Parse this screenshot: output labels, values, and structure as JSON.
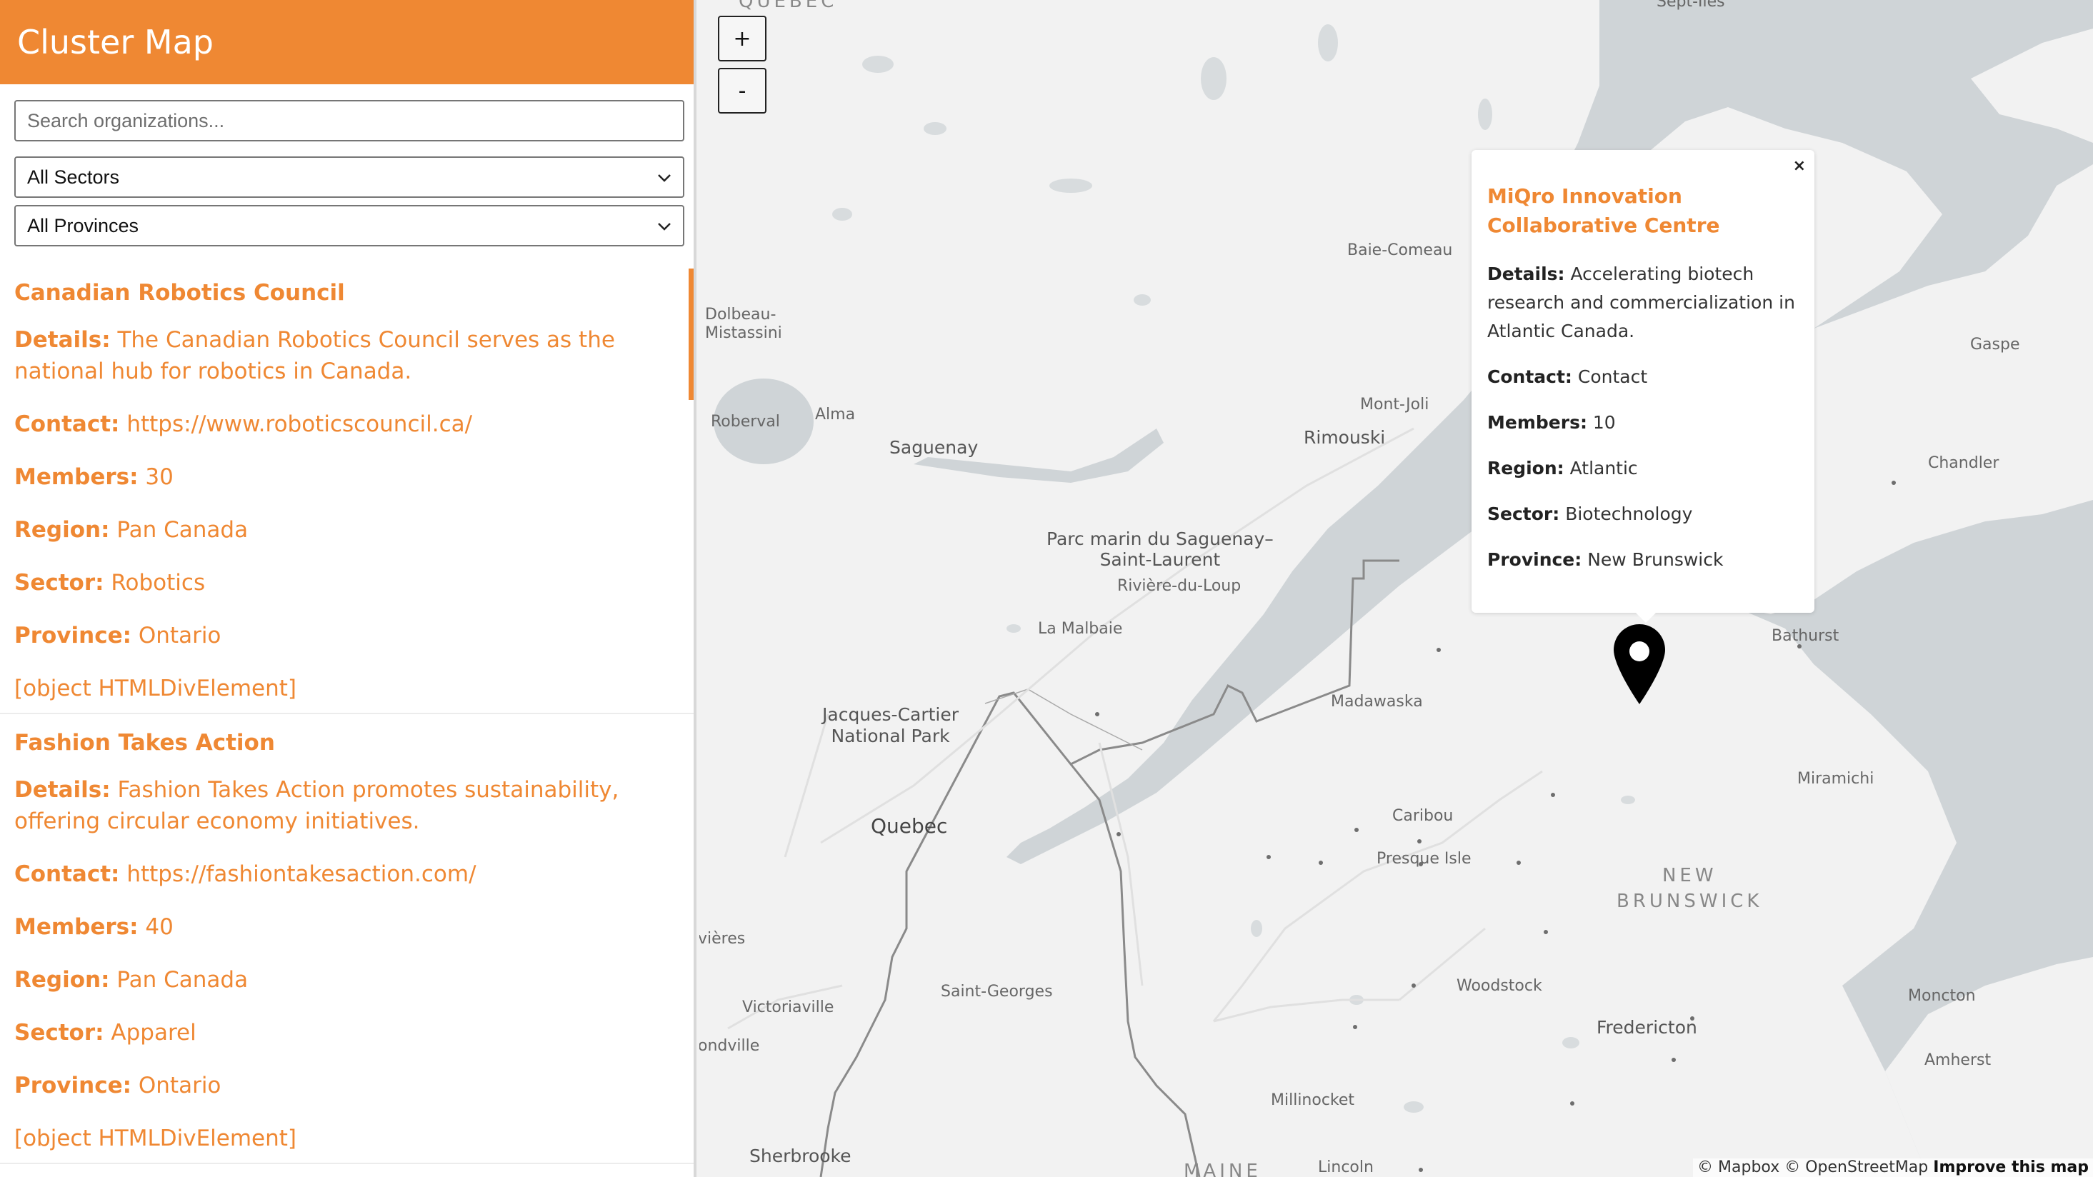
{
  "app": {
    "title": "Cluster Map"
  },
  "filters": {
    "search_placeholder": "Search organizations...",
    "sector_selected": "All Sectors",
    "province_selected": "All Provinces"
  },
  "organizations": [
    {
      "name": "Canadian Robotics Council",
      "details_label": "Details:",
      "details": "The Canadian Robotics Council serves as the national hub for robotics in Canada.",
      "contact_label": "Contact:",
      "contact": "https://www.roboticscouncil.ca/",
      "members_label": "Members:",
      "members": "30",
      "region_label": "Region:",
      "region": "Pan Canada",
      "sector_label": "Sector:",
      "sector": "Robotics",
      "province_label": "Province:",
      "province": "Ontario",
      "extra": "[object HTMLDivElement]"
    },
    {
      "name": "Fashion Takes Action",
      "details_label": "Details:",
      "details": "Fashion Takes Action promotes sustainability, offering circular economy initiatives.",
      "contact_label": "Contact:",
      "contact": "https://fashiontakesaction.com/",
      "members_label": "Members:",
      "members": "40",
      "region_label": "Region:",
      "region": "Pan Canada",
      "sector_label": "Sector:",
      "sector": "Apparel",
      "province_label": "Province:",
      "province": "Ontario",
      "extra": "[object HTMLDivElement]"
    }
  ],
  "map": {
    "zoom_in_label": "+",
    "zoom_out_label": "-",
    "labels": {
      "quebec_region": "QUEBEC",
      "sept_iles": "Sept-Îles",
      "baie_comeau": "Baie-Comeau",
      "dolbeau": "Dolbeau-\nMistassini",
      "roberval": "Roberval",
      "alma": "Alma",
      "saguenay": "Saguenay",
      "mont_joli": "Mont-Joli",
      "rimouski": "Rimouski",
      "gaspe": "Gaspe",
      "chandler": "Chandler",
      "parc_marin": "Parc marin du Saguenay–\nSaint-Laurent",
      "riviere_du_loup": "Rivière-du-Loup",
      "la_malbaie": "La Malbaie",
      "jacques_cartier": "Jacques-Cartier\nNational Park",
      "madawaska": "Madawaska",
      "bathurst": "Bathurst",
      "quebec_city": "Quebec",
      "caribou": "Caribou",
      "presque_isle": "Presque Isle",
      "miramichi": "Miramichi",
      "new_brunswick": "NEW\nBRUNSWICK",
      "rivieres": "vières",
      "victoriaville": "Victoriaville",
      "saint_georges": "Saint-Georges",
      "woodstock": "Woodstock",
      "fredericton": "Fredericton",
      "moncton": "Moncton",
      "drummondville": "ondville",
      "amherst": "Amherst",
      "millinocket": "Millinocket",
      "sherbrooke": "Sherbrooke",
      "maine": "MAINE",
      "lincoln": "Lincoln"
    },
    "attribution": "© Mapbox © OpenStreetMap",
    "attribution_link": "Improve this map"
  },
  "popup": {
    "close": "×",
    "title": "MiQro Innovation Collaborative Centre",
    "details_label": "Details:",
    "details": "Accelerating biotech research and commercialization in Atlantic Canada.",
    "contact_label": "Contact:",
    "contact": "Contact",
    "members_label": "Members:",
    "members": "10",
    "region_label": "Region:",
    "region": "Atlantic",
    "sector_label": "Sector:",
    "sector": "Biotechnology",
    "province_label": "Province:",
    "province": "New Brunswick"
  },
  "colors": {
    "accent": "#ef8833",
    "water": "#cfd4d7",
    "land": "#f2f2f2"
  }
}
